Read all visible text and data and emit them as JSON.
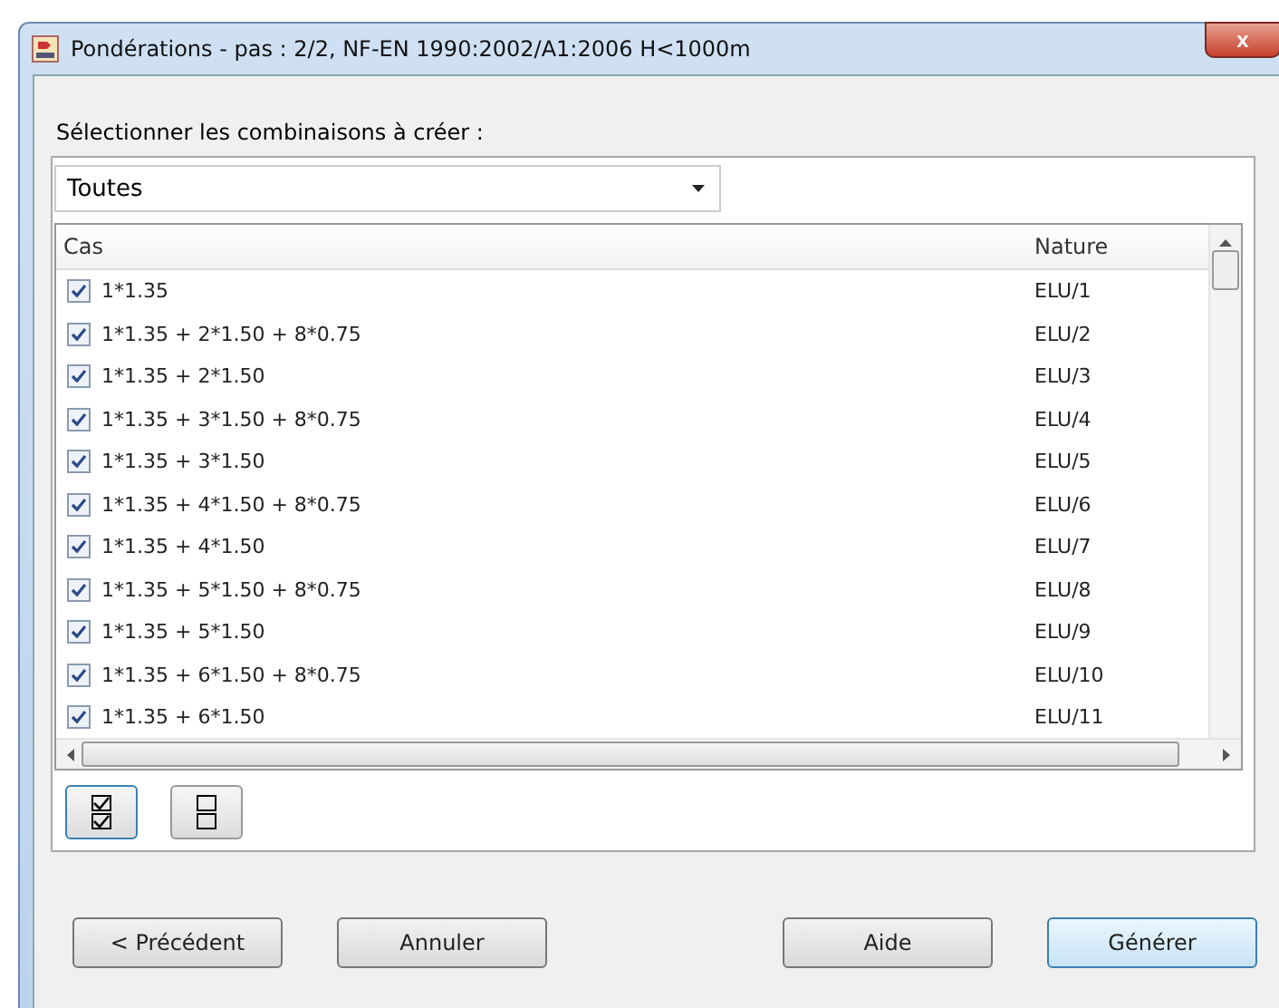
{
  "window": {
    "title": "Pondérations - pas : 2/2, NF-EN 1990:2002/A1:2006 H<1000m",
    "close": "x"
  },
  "prompt": "Sélectionner les combinaisons à créer :",
  "dropdown": {
    "value": "Toutes"
  },
  "table": {
    "columns": [
      "Cas",
      "Nature"
    ],
    "rows": [
      {
        "cas": "1*1.35",
        "nature": "ELU/1",
        "checked": true
      },
      {
        "cas": "1*1.35 + 2*1.50 + 8*0.75",
        "nature": "ELU/2",
        "checked": true
      },
      {
        "cas": "1*1.35 + 2*1.50",
        "nature": "ELU/3",
        "checked": true
      },
      {
        "cas": "1*1.35 + 3*1.50 + 8*0.75",
        "nature": "ELU/4",
        "checked": true
      },
      {
        "cas": "1*1.35 + 3*1.50",
        "nature": "ELU/5",
        "checked": true
      },
      {
        "cas": "1*1.35 + 4*1.50 + 8*0.75",
        "nature": "ELU/6",
        "checked": true
      },
      {
        "cas": "1*1.35 + 4*1.50",
        "nature": "ELU/7",
        "checked": true
      },
      {
        "cas": "1*1.35 + 5*1.50 + 8*0.75",
        "nature": "ELU/8",
        "checked": true
      },
      {
        "cas": "1*1.35 + 5*1.50",
        "nature": "ELU/9",
        "checked": true
      },
      {
        "cas": "1*1.35 + 6*1.50 + 8*0.75",
        "nature": "ELU/10",
        "checked": true
      },
      {
        "cas": "1*1.35 + 6*1.50",
        "nature": "ELU/11",
        "checked": true
      }
    ]
  },
  "buttons": [
    {
      "label": "< Précédent",
      "kind": "left"
    },
    {
      "label": "Annuler",
      "kind": "left"
    },
    {
      "label": "Aide",
      "kind": "right"
    },
    {
      "label": "Générer",
      "kind": "default"
    }
  ]
}
